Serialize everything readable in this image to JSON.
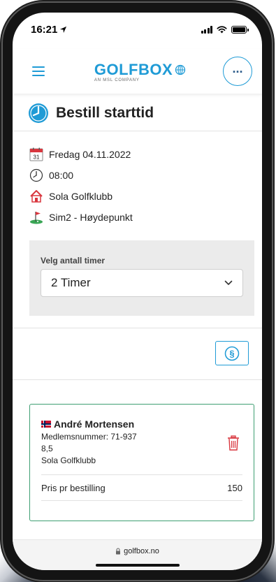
{
  "status_bar": {
    "time": "16:21"
  },
  "header": {
    "logo_text": "GOLFBOX",
    "logo_subtitle": "AN MSL COMPANY",
    "more_label": "..."
  },
  "page": {
    "title": "Bestill starttid"
  },
  "booking": {
    "calendar_day": "31",
    "date": "Fredag 04.11.2022",
    "time": "08:00",
    "club": "Sola Golfklubb",
    "course": "Sim2 - Høydepunkt"
  },
  "hours": {
    "label": "Velg antall timer",
    "selected": "2 Timer"
  },
  "rules_button": {
    "symbol": "§"
  },
  "player": {
    "name": "André Mortensen",
    "member_number": "Medlemsnummer: 71-937",
    "handicap": "8,5",
    "club": "Sola Golfklubb",
    "price_label": "Pris pr bestilling",
    "price_value": "150"
  },
  "browser": {
    "url": "golfbox.no"
  },
  "colors": {
    "brand_blue": "#1f9bd6",
    "card_border_green": "#3e9e72",
    "trash_red": "#d9363e"
  }
}
